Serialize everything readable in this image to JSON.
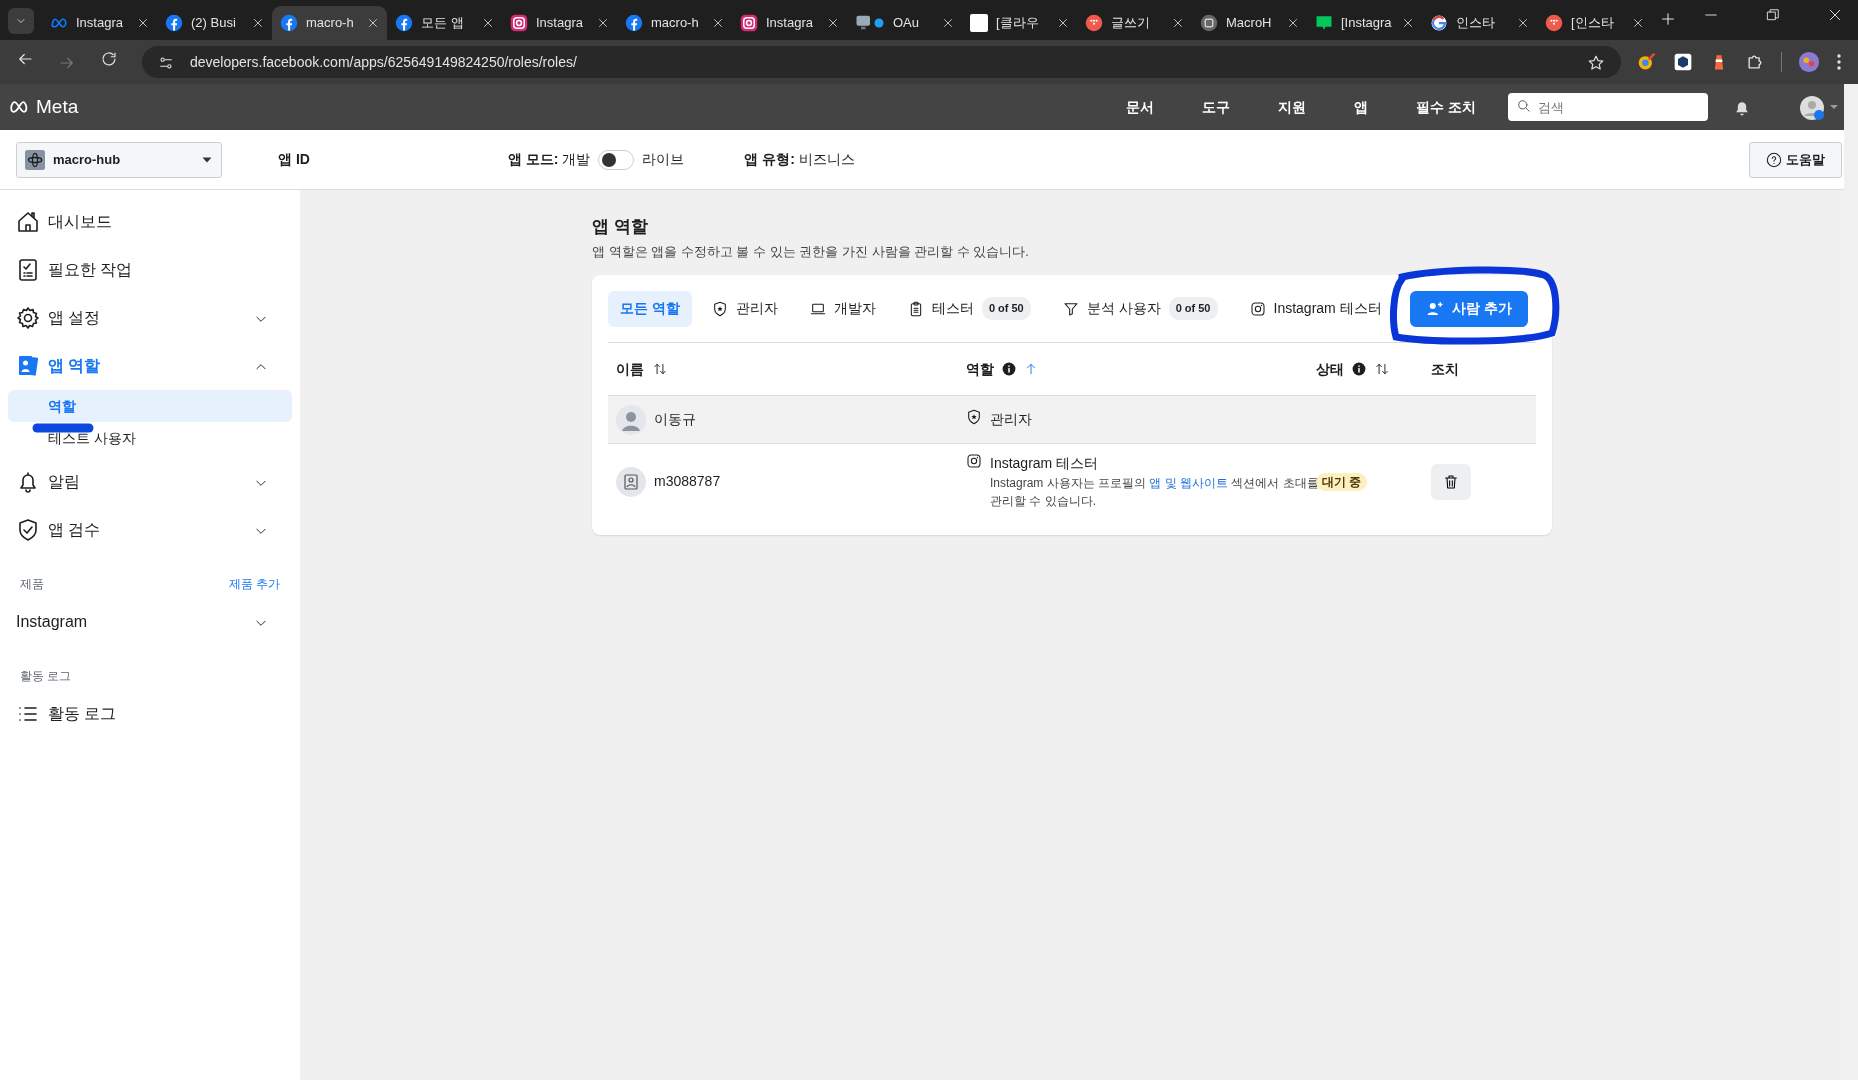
{
  "browser": {
    "tabs": [
      {
        "label": "Instagra",
        "kind": "meta",
        "selected": false
      },
      {
        "label": "(2) Busi",
        "kind": "facebook",
        "selected": false
      },
      {
        "label": "macro-h",
        "kind": "facebook",
        "selected": true
      },
      {
        "label": "모든 앱",
        "kind": "facebook",
        "selected": false
      },
      {
        "label": "Instagra",
        "kind": "instagram",
        "selected": false
      },
      {
        "label": "macro-h",
        "kind": "facebook",
        "selected": false
      },
      {
        "label": "Instagra",
        "kind": "instagram",
        "selected": false
      },
      {
        "label": "OAu",
        "kind": "monitor",
        "selected": false
      },
      {
        "label": "[클라우",
        "kind": "letter-g",
        "selected": false
      },
      {
        "label": "글쓰기",
        "kind": "red-circle",
        "selected": false
      },
      {
        "label": "MacroH",
        "kind": "grey-circle",
        "selected": false
      },
      {
        "label": "[Instagra",
        "kind": "blog",
        "selected": false
      },
      {
        "label": "인스타",
        "kind": "google",
        "selected": false
      },
      {
        "label": "[인스타",
        "kind": "red-circle",
        "selected": false
      }
    ],
    "url": "developers.facebook.com/apps/625649149824250/roles/roles/"
  },
  "header": {
    "logo": "Meta",
    "nav": [
      "문서",
      "도구",
      "지원",
      "앱",
      "필수 조치"
    ],
    "search": {
      "placeholder": "검색"
    }
  },
  "app_bar": {
    "app_name": "macro-hub",
    "app_id_label": "앱 ID",
    "mode_label": "앱 모드:",
    "mode_value": "개발",
    "live_toggle": {
      "on": false
    },
    "live_label": "라이브",
    "type_label": "앱 유형:",
    "type_value": "비즈니스",
    "help": "도움말"
  },
  "sidebar": {
    "items": [
      {
        "label": "대시보드",
        "kind": "link",
        "selected": false
      },
      {
        "label": "필요한 작업",
        "kind": "link",
        "selected": false
      },
      {
        "label": "앱 설정",
        "kind": "group",
        "selected": false,
        "expanded": false
      },
      {
        "label": "앱 역할",
        "kind": "group",
        "selected": true,
        "expanded": true,
        "children": [
          {
            "label": "역할",
            "selected": true
          },
          {
            "label": "테스트 사용자",
            "selected": false
          }
        ]
      },
      {
        "label": "알림",
        "kind": "group",
        "selected": false,
        "expanded": false
      },
      {
        "label": "앱 검수",
        "kind": "group",
        "selected": false,
        "expanded": false
      }
    ],
    "sections": [
      {
        "heading": "제품",
        "action": "제품 추가",
        "items": [
          {
            "label": "Instagram",
            "kind": "group",
            "selected": false,
            "expanded": false
          }
        ]
      },
      {
        "heading": "활동 로그",
        "items": [
          {
            "label": "활동 로그",
            "kind": "link",
            "selected": false
          }
        ]
      }
    ]
  },
  "page": {
    "title": "앱 역할",
    "subtitle": "앱 역할은 앱을 수정하고 볼 수 있는 권한을 가진 사람을 관리할 수 있습니다.",
    "filters": [
      {
        "label": "모든 역할",
        "selected": true
      },
      {
        "label": "관리자",
        "selected": false
      },
      {
        "label": "개발자",
        "selected": false
      },
      {
        "label": "테스터",
        "count": "0 of 50",
        "selected": false
      },
      {
        "label": "분석 사용자",
        "count": "0 of 50",
        "selected": false
      },
      {
        "label": "Instagram 테스터",
        "selected": false
      }
    ],
    "add_button": "사람 추가",
    "table": {
      "columns": [
        {
          "label": "이름",
          "sortable": true,
          "sorted": false
        },
        {
          "label": "역할",
          "info": true,
          "sortable": true,
          "sorted": true
        },
        {
          "label": "상태",
          "info": true,
          "sortable": true,
          "sorted": false
        },
        {
          "label": "조치"
        }
      ],
      "rows": [
        {
          "name": "이동규",
          "kind": "admin",
          "role": "관리자",
          "highlighted": true
        },
        {
          "name": "m3088787",
          "kind": "instagram",
          "role": "Instagram 테스터",
          "note_before": "Instagram 사용자는 프로필의 ",
          "note_link": "앱 및 웹사이트",
          "note_after": " 섹션에서 초대를 관리할 수 있습니다.",
          "status": "대기 중",
          "delete": true,
          "highlighted": false
        }
      ]
    }
  }
}
